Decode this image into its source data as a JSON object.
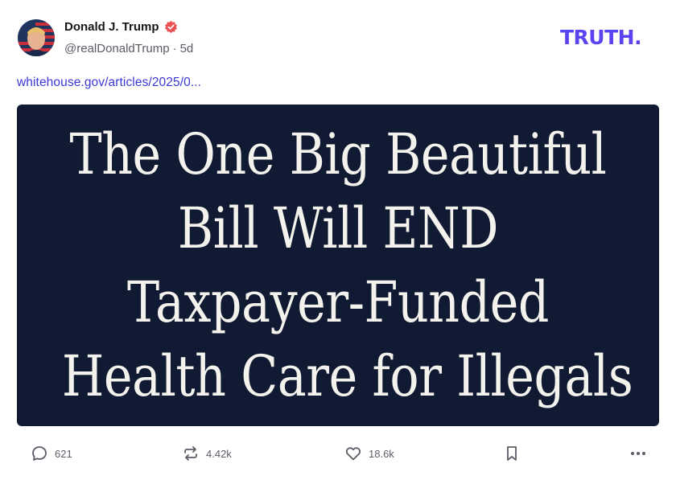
{
  "post": {
    "display_name": "Donald J. Trump",
    "handle": "@realDonaldTrump",
    "separator": "·",
    "age": "5d",
    "link_text": "whitehouse.gov/articles/2025/0...",
    "media_lines": [
      "The One Big Beautiful",
      "Bill Will END",
      "Taxpayer-Funded",
      "Health Care for Illegals"
    ]
  },
  "brand": {
    "logo_text": "TRUTH.",
    "color": "#5a44f2",
    "accent": "#3fd3c9"
  },
  "actions": {
    "replies": "621",
    "retruths": "4.42k",
    "likes": "18.6k"
  },
  "icons": {
    "verified": "verified-badge-icon",
    "reply": "speech-bubble-icon",
    "retruth": "repost-arrows-icon",
    "like": "heart-icon",
    "bookmark": "bookmark-icon",
    "more": "ellipsis-icon"
  },
  "colors": {
    "media_background": "#111a33",
    "media_text": "#f4f2ec",
    "link": "#3b37d6",
    "verified": "#ea4f52"
  }
}
